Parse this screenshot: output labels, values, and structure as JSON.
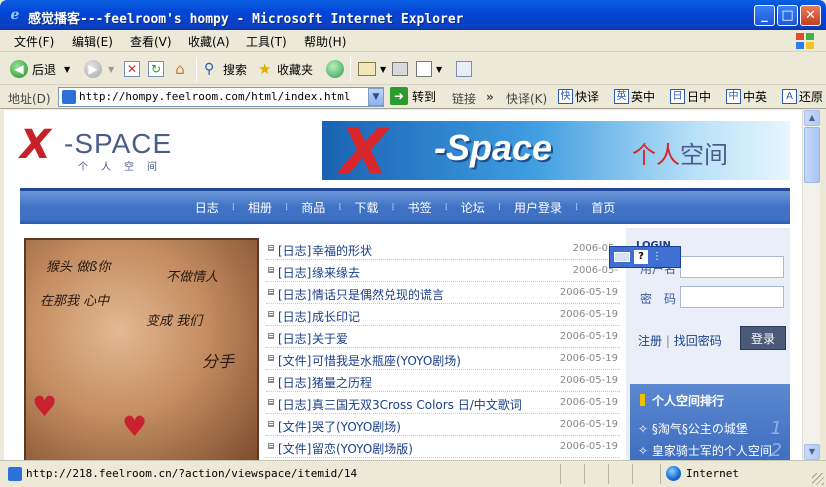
{
  "window": {
    "title": "感觉播客---feelroom's hompy - Microsoft Internet Explorer"
  },
  "menu": {
    "items": [
      "文件(F)",
      "编辑(E)",
      "查看(V)",
      "收藏(A)",
      "工具(T)",
      "帮助(H)"
    ]
  },
  "toolbar": {
    "back_label": "后退",
    "search_label": "搜索",
    "favorites_label": "收藏夹"
  },
  "address": {
    "label": "地址(D)",
    "url": "http://hompy.feelroom.com/html/index.html",
    "go_label": "转到",
    "links_label": "链接",
    "quick_label": "快译(K)",
    "translate_buttons": [
      {
        "box": "快",
        "label": "快译"
      },
      {
        "box": "英",
        "label": "英中"
      },
      {
        "box": "日",
        "label": "日中"
      },
      {
        "box": "中",
        "label": "中英"
      },
      {
        "box": "A",
        "label": "还原"
      }
    ]
  },
  "site": {
    "logo_main": "X-SPACE",
    "logo_x": "X",
    "logo_word": "-SPACE",
    "logo_sub": "个人空间",
    "banner_space": "-Space",
    "banner_cn_red": "个人",
    "banner_cn_blue": "空间",
    "nav": [
      "日志",
      "相册",
      "商品",
      "下载",
      "书签",
      "论坛",
      "用户登录",
      "首页"
    ]
  },
  "entries": [
    {
      "cat": "[日志]",
      "title": "幸福的形状",
      "date": "2006-05-"
    },
    {
      "cat": "[日志]",
      "title": "缘来缘去",
      "date": "2006-05-"
    },
    {
      "cat": "[日志]",
      "title": "情话只是偶然兑现的谎言",
      "date": "2006-05-19"
    },
    {
      "cat": "[日志]",
      "title": "成长印记",
      "date": "2006-05-19"
    },
    {
      "cat": "[日志]",
      "title": "关于爱",
      "date": "2006-05-19"
    },
    {
      "cat": "[文件]",
      "title": "可惜我是水瓶座(YOYO剧场)",
      "date": "2006-05-19"
    },
    {
      "cat": "[日志]",
      "title": "猪量之历程",
      "date": "2006-05-19"
    },
    {
      "cat": "[日志]",
      "title": "真三国无双3Cross Colors 日/中文歌词",
      "date": "2006-05-19"
    },
    {
      "cat": "[文件]",
      "title": "哭了(YOYO剧场)",
      "date": "2006-05-19"
    },
    {
      "cat": "[文件]",
      "title": "留恋(YOYO剧场版)",
      "date": "2006-05-19"
    }
  ],
  "login": {
    "title": "LOGIN",
    "username_label": "用户名",
    "password_label": "密　码",
    "register": "注册",
    "forgot": "找回密码",
    "submit": "登录"
  },
  "ranking": {
    "title": "个人空间排行",
    "items": [
      "§淘气§公主の城堡",
      "皇家骑士军的个人空间"
    ],
    "nums": [
      "1",
      "2"
    ]
  },
  "photo": {
    "writing": [
      "猴头 做ß你",
      "不做情人",
      "在那我 心中",
      "变成 我们",
      "分手"
    ]
  },
  "status": {
    "text": "http://218.feelroom.cn/?action/viewspace/itemid/14",
    "zone": "Internet"
  },
  "colors": {
    "titlebar": "#0346D6",
    "nav": "#3f72c5",
    "link": "#1b3f8b",
    "accent_red": "#d8262a"
  }
}
